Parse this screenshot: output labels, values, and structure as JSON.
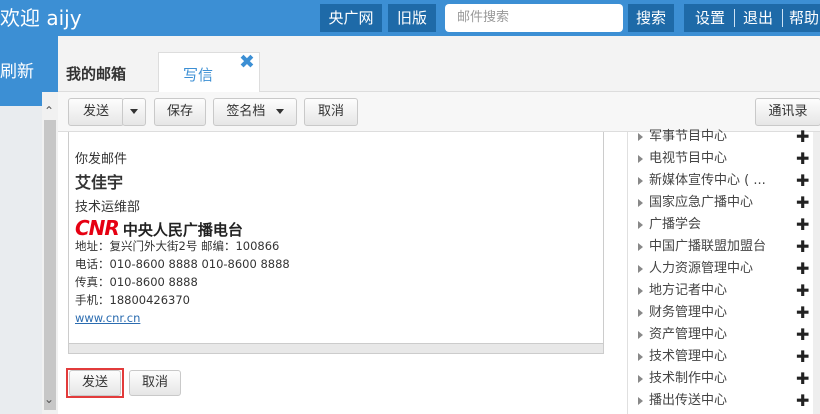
{
  "header": {
    "welcome": "欢迎 aijy",
    "btn_cnr": "央广网",
    "btn_old": "旧版",
    "search_placeholder": "邮件搜索",
    "btn_search": "搜索",
    "settings": "设置",
    "logout": "退出",
    "help": "帮助"
  },
  "sidebar": {
    "refresh": "刷新"
  },
  "tabs": {
    "inbox": "我的邮箱",
    "compose": "写信"
  },
  "toolbar": {
    "send": "发送",
    "save": "保存",
    "signature": "签名档",
    "cancel": "取消",
    "contacts": "通讯录"
  },
  "signature": {
    "line1": "你发邮件",
    "name": "艾佳宇",
    "dept": "技术运维部",
    "logo_letters": "CNR",
    "logo_text": "中央人民广播电台",
    "address": "地址：复兴门外大街2号   邮编：100866",
    "phone": "电话：010-8600 8888 010-8600 8888",
    "fax": "传真：010-8600 8888",
    "mobile": "手机：18800426370",
    "website": "www.cnr.cn"
  },
  "bottom": {
    "send": "发送",
    "cancel": "取消"
  },
  "contacts_panel": {
    "items": [
      "军事节目中心",
      "电视节目中心",
      "新媒体宣传中心 ( ...",
      "国家应急广播中心",
      "广播学会",
      "中国广播联盟加盟台",
      "人力资源管理中心",
      "地方记者中心",
      "财务管理中心",
      "资产管理中心",
      "技术管理中心",
      "技术制作中心",
      "播出传送中心"
    ]
  },
  "colors": {
    "brand": "#3c8fd4",
    "highlight": "#e23b3b"
  }
}
